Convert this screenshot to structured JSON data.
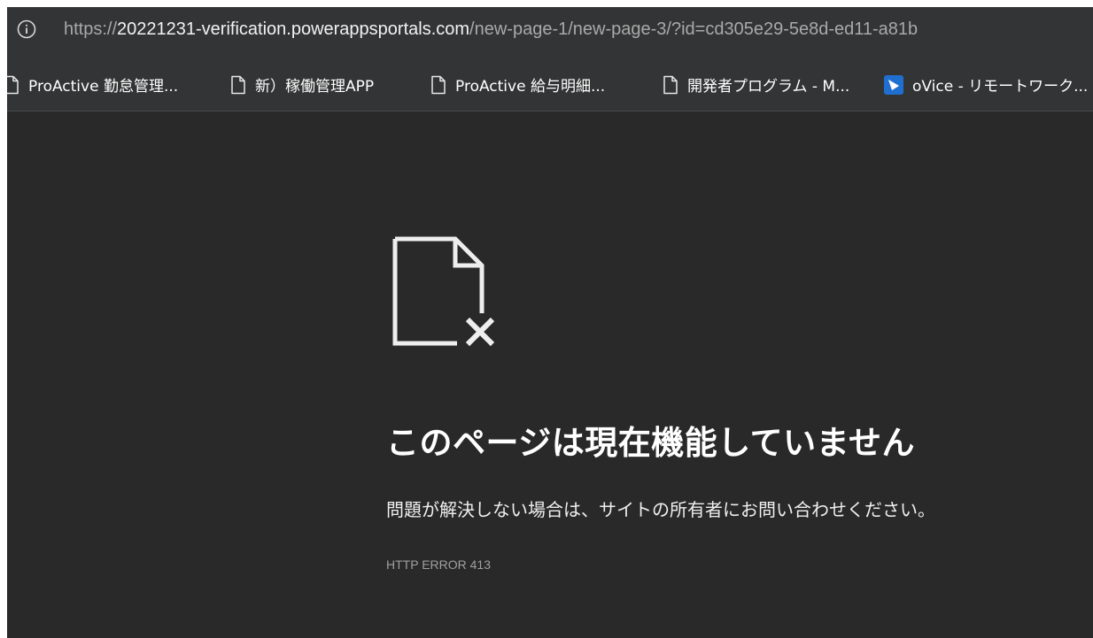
{
  "address_bar": {
    "info_icon": "info-circle-icon",
    "url_scheme": "https://",
    "url_domain": "20221231-verification.powerappsportals.com",
    "url_path": "/new-page-1/new-page-3/?id=cd305e29-5e8d-ed11-a81b"
  },
  "bookmarks": {
    "items": [
      {
        "label": "ProActive 勤怠管理...",
        "icon": "page-icon"
      },
      {
        "label": "新）稼働管理APP",
        "icon": "page-icon"
      },
      {
        "label": "ProActive 給与明細...",
        "icon": "page-icon"
      },
      {
        "label": "開発者プログラム - M...",
        "icon": "page-icon"
      },
      {
        "label": "oVice - リモートワーク...",
        "icon": "ovice-icon"
      }
    ]
  },
  "error": {
    "icon": "broken-page-icon",
    "title": "このページは現在機能していません",
    "description": "問題が解決しない場合は、サイトの所有者にお問い合わせください。",
    "code": "HTTP ERROR 413"
  },
  "colors": {
    "page_background": "#292929",
    "toolbar_background": "#333435",
    "text_primary": "#ffffff",
    "text_muted": "#a0a0a0",
    "ovice_brand": "#1f6fd0"
  }
}
